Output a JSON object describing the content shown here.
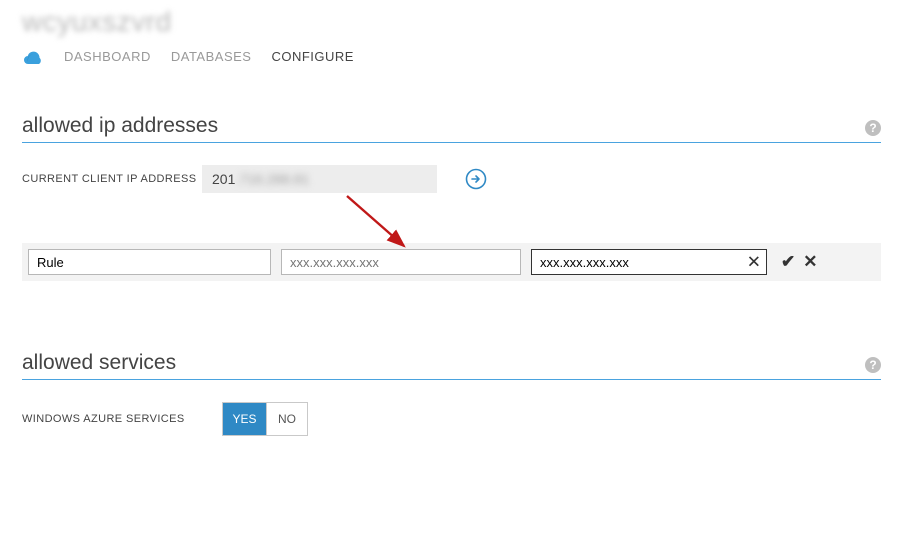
{
  "header": {
    "server_name": "wcyuxszvrd",
    "tabs": {
      "dashboard": "DASHBOARD",
      "databases": "DATABASES",
      "configure": "CONFIGURE"
    }
  },
  "sections": {
    "allowed_ip": {
      "title": "allowed ip addresses",
      "current_client_label": "CURRENT CLIENT IP ADDRESS",
      "current_client_ip_prefix": "201",
      "current_client_ip_hidden": ".716.288.81",
      "rule_row": {
        "name_value": "Rule",
        "start_ip_placeholder": "xxx.xxx.xxx.xxx",
        "end_ip_value": "xxx.xxx.xxx.xxx"
      }
    },
    "allowed_services": {
      "title": "allowed services",
      "windows_azure_label": "WINDOWS AZURE SERVICES",
      "yes": "YES",
      "no": "NO"
    }
  },
  "icons": {
    "help": "?",
    "check": "✔",
    "cross": "✕",
    "clear": "✕"
  }
}
